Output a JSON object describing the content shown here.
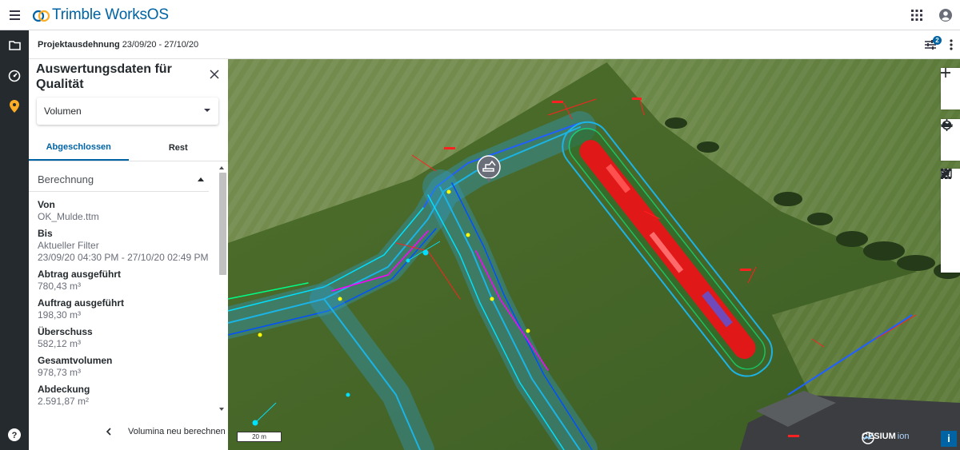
{
  "app": {
    "brand": "Trimble WorksOS"
  },
  "subheader": {
    "label": "Projektausdehnung",
    "range": "23/09/20 - 27/10/20",
    "filter_badge": "2"
  },
  "panel": {
    "title": "Auswertungsdaten für Qualität",
    "select_value": "Volumen",
    "tabs": [
      {
        "label": "Abgeschlossen",
        "active": true
      },
      {
        "label": "Rest",
        "active": false
      }
    ],
    "section": "Berechnung",
    "items": [
      {
        "label": "Von",
        "value": "OK_Mulde.ttm"
      },
      {
        "label": "Bis",
        "value": "Aktueller Filter",
        "value2": "23/09/20 04:30 PM - 27/10/20 02:49 PM"
      },
      {
        "label": "Abtrag ausgeführt",
        "value": "780,43 m³"
      },
      {
        "label": "Auftrag ausgeführt",
        "value": "198,30 m³"
      },
      {
        "label": "Überschuss",
        "value": "582,12 m³"
      },
      {
        "label": "Gesamtvolumen",
        "value": "978,73 m³"
      },
      {
        "label": "Abdeckung",
        "value": "2.591,87 m²"
      }
    ],
    "footer_action": "Volumina neu berechnen"
  },
  "map": {
    "scale": "20 m",
    "attribution": "CESIUM",
    "attribution_suffix": "ion",
    "info_label": "i"
  },
  "icons": {
    "menu": "hamburger-icon",
    "apps": "grid-icon",
    "account": "user-icon",
    "rail": [
      "folder-icon",
      "gauge-icon",
      "location-pin-icon",
      "help-icon"
    ],
    "map_tools": [
      "zoom-in-icon",
      "zoom-out-icon",
      "locate-icon",
      "terrain-icon",
      "pencil-icon",
      "map-icon",
      "check-icon",
      "close-icon",
      "pattern-icon"
    ]
  },
  "colors": {
    "brand": "#0063a3",
    "rail_bg": "#252a2e",
    "active_rail": "#fbad26"
  }
}
